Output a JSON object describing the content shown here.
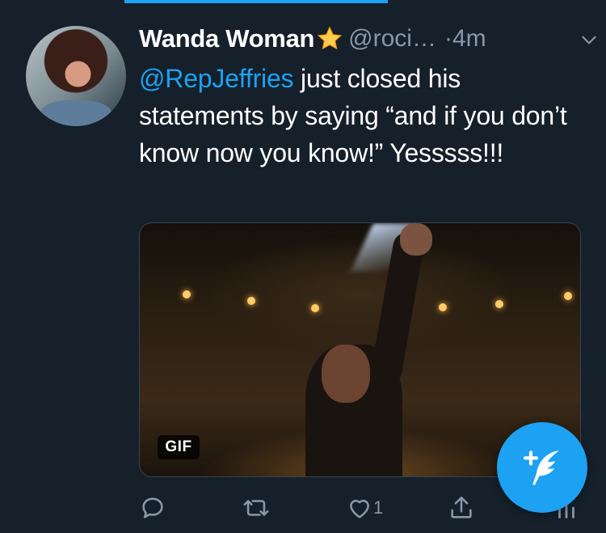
{
  "colors": {
    "background": "#15202b",
    "accent": "#1da1f2",
    "secondary_text": "#8899a6",
    "primary_text": "#ffffff"
  },
  "tweet": {
    "display_name": "Wanda Woman",
    "name_emoji": "star",
    "handle": "@roci…",
    "time": "·4m",
    "mention": "@RepJeffries",
    "text": " just closed his statements by saying “and if you don’t know now you know!” Yesssss!!!",
    "media": {
      "badge": "GIF"
    },
    "actions": {
      "reply_icon": "reply-icon",
      "retweet_icon": "retweet-icon",
      "like_icon": "heart-icon",
      "like_count": "1",
      "share_icon": "share-icon",
      "analytics_icon": "analytics-icon"
    }
  },
  "compose": {
    "icon": "compose-tweet-icon"
  }
}
